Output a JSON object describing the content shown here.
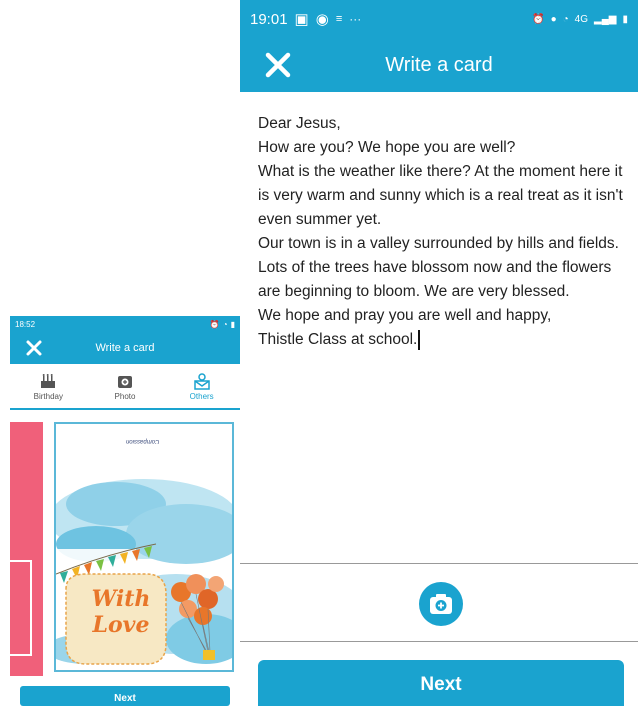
{
  "left_screen": {
    "status": {
      "time": "18:52",
      "icons_left": [
        "chrome-icon",
        "mail-icon",
        "messenger-icon",
        "more-icon"
      ],
      "icons_right": [
        "alarm-icon",
        "location-icon",
        "wifi-icon",
        "signal-icon",
        "battery-icon"
      ]
    },
    "header": {
      "title": "Write a card"
    },
    "tabs": [
      {
        "label": "Birthday",
        "icon": "cake-icon",
        "active": false
      },
      {
        "label": "Photo",
        "icon": "camera-icon",
        "active": false
      },
      {
        "label": "Others",
        "icon": "envelope-person-icon",
        "active": true
      }
    ],
    "card": {
      "logo_text": "Compassion",
      "greeting_line1": "With",
      "greeting_line2": "Love"
    },
    "next_label": "Next"
  },
  "right_screen": {
    "status": {
      "time": "19:01",
      "more": "···",
      "network": "4G"
    },
    "header": {
      "title": "Write a card"
    },
    "message": [
      "Dear Jesus,",
      "How are you? We hope you are well?",
      "What is the weather like there? At the moment here it is very warm and sunny which is a real treat as it isn't even summer yet.",
      "Our town is in a valley surrounded by hills and fields. Lots of the trees have blossom now and the flowers are beginning to bloom. We are very blessed.",
      "We hope and pray you are well and happy,",
      "Thistle Class at school."
    ],
    "next_label": "Next"
  },
  "colors": {
    "accent": "#1aa3cf",
    "pink": "#f0607a",
    "card_orange": "#e8762a"
  }
}
